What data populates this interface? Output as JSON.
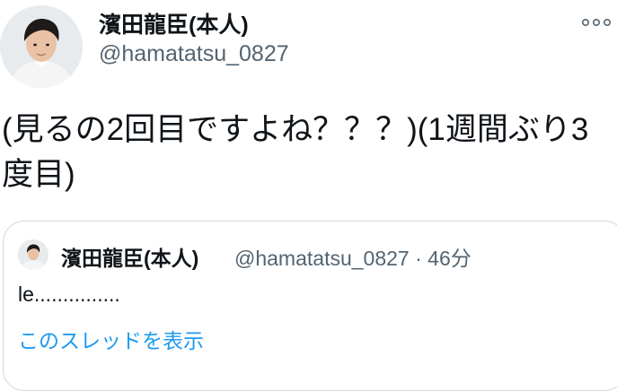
{
  "author": {
    "display_name": "濱田龍臣(本人)",
    "handle": "@hamatatsu_0827",
    "avatar_icon": "profile-photo"
  },
  "menu": {
    "icon": "more-options-icon"
  },
  "tweet": {
    "text": "(見るの2回目ですよね？？？)(1週間ぶり3度目)"
  },
  "quoted_tweet": {
    "display_name": "濱田龍臣(本人)",
    "handle": "@hamatatsu_0827",
    "separator": "·",
    "time": "46分",
    "text": "le...............",
    "show_thread": "このスレッドを表示"
  },
  "colors": {
    "text": "#0f1419",
    "secondary": "#536471",
    "link": "#1d9bf0",
    "border": "#cfd9de"
  }
}
